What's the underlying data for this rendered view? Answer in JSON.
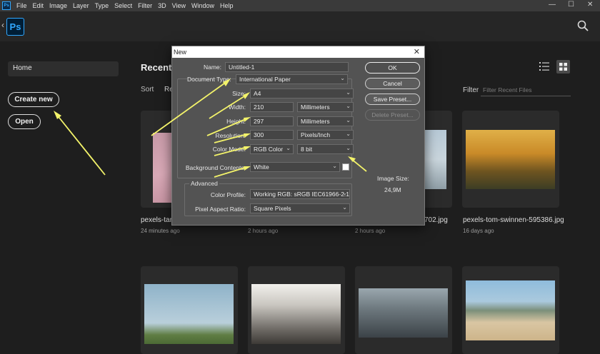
{
  "menubar": {
    "logo": "Ps",
    "items": [
      "File",
      "Edit",
      "Image",
      "Layer",
      "Type",
      "Select",
      "Filter",
      "3D",
      "View",
      "Window",
      "Help"
    ],
    "window_controls": [
      "—",
      "☐",
      "✕"
    ]
  },
  "header": {
    "logo": "Ps",
    "back_icon": "chevron-left-icon",
    "search_icon": "search-icon"
  },
  "sidebar": {
    "home": "Home",
    "create_new": "Create new",
    "open": "Open"
  },
  "recent": {
    "title": "Recent",
    "sort_label": "Sort",
    "sort_value": "Re",
    "filter_label": "Filter",
    "filter_placeholder": "Filter Recent Files",
    "files": [
      {
        "name": "pexels-tary",
        "time": "24 minutes ago"
      },
      {
        "name": "",
        "time": "2 hours ago"
      },
      {
        "name": "702.jpg",
        "time": "2 hours ago"
      },
      {
        "name": "pexels-tom-swinnen-595386.jpg",
        "time": "16 days ago"
      },
      {
        "name": "",
        "time": ""
      },
      {
        "name": "",
        "time": ""
      },
      {
        "name": "",
        "time": ""
      },
      {
        "name": "",
        "time": ""
      }
    ]
  },
  "dialog": {
    "title": "New",
    "close": "✕",
    "name_label": "Name:",
    "name_value": "Untitled-1",
    "doc_type_label": "Document Type:",
    "doc_type_value": "International Paper",
    "size_label": "Size:",
    "size_value": "A4",
    "width_label": "Width:",
    "width_value": "210",
    "width_unit": "Millimeters",
    "height_label": "Height:",
    "height_value": "297",
    "height_unit": "Millimeters",
    "resolution_label": "Resolution:",
    "resolution_value": "300",
    "resolution_unit": "Pixels/Inch",
    "color_mode_label": "Color Mode:",
    "color_mode_value": "RGB Color",
    "bit_depth_value": "8 bit",
    "bg_label": "Background Contents:",
    "bg_value": "White",
    "advanced_title": "Advanced",
    "color_profile_label": "Color Profile:",
    "color_profile_value": "Working RGB:  sRGB IEC61966-2.1",
    "pixel_aspect_label": "Pixel Aspect Ratio:",
    "pixel_aspect_value": "Square Pixels",
    "buttons": {
      "ok": "OK",
      "cancel": "Cancel",
      "save_preset": "Save Preset...",
      "delete_preset": "Delete Preset..."
    },
    "image_size_label": "Image Size:",
    "image_size_value": "24,9M"
  },
  "colors": {
    "annotation_arrow": "#f3f36a",
    "ps_blue": "#31a8ff",
    "background": "#1e1e1e"
  }
}
